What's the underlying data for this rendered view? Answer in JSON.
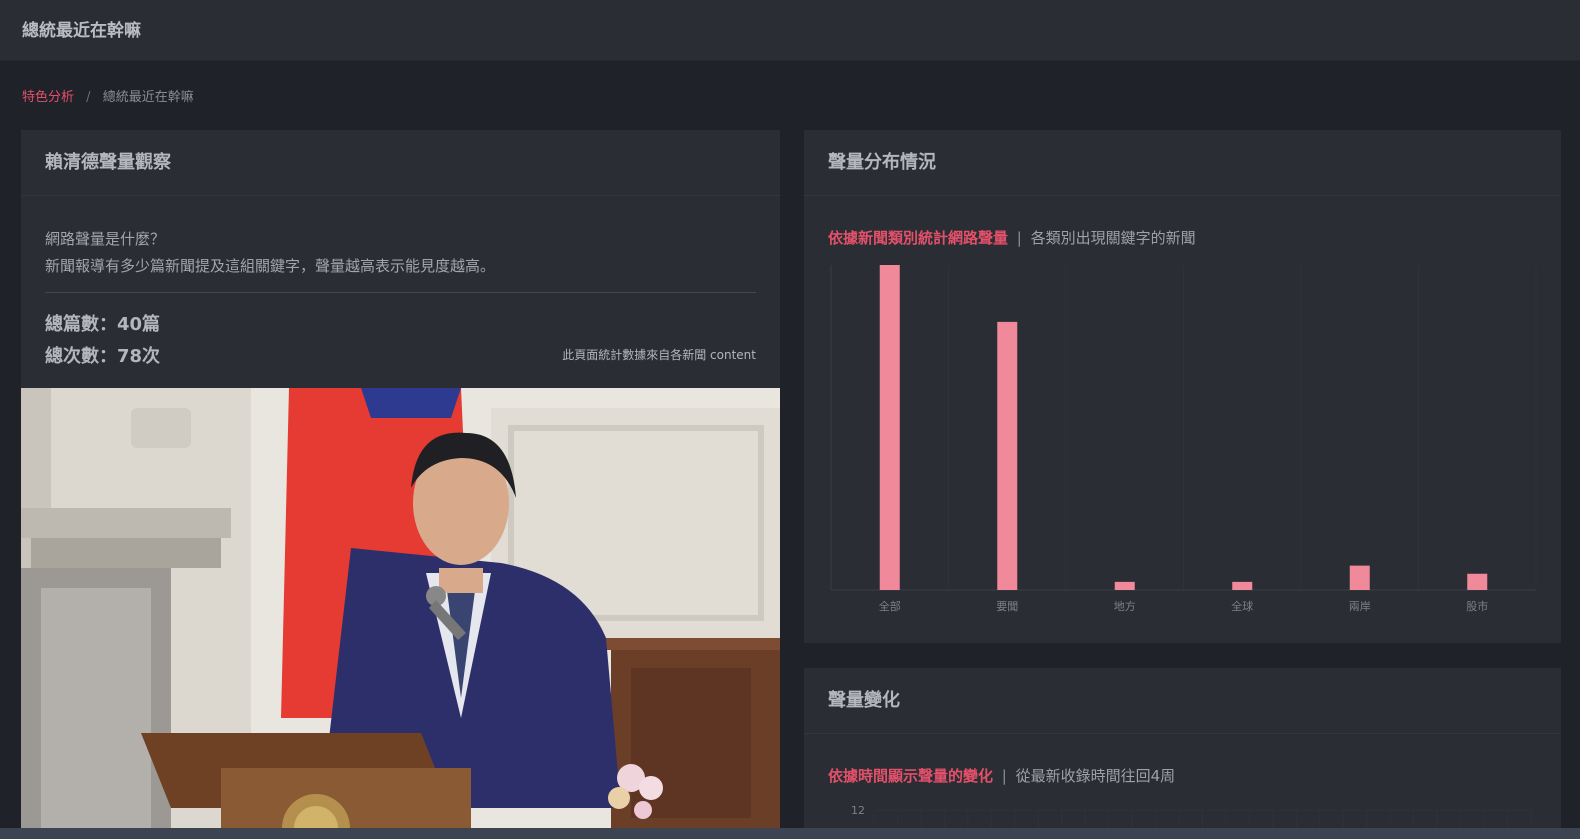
{
  "topbar": {
    "title": "總統最近在幹嘛"
  },
  "breadcrumb": {
    "parent": "特色分析",
    "separator": "/",
    "current": "總統最近在幹嘛"
  },
  "left_card": {
    "title": "賴清德聲量觀察",
    "desc_line1": "網路聲量是什麼？",
    "desc_line2": "新聞報導有多少篇新聞提及這組關鍵字，聲量越高表示能見度越高。",
    "total_articles": "總篇數：40篇",
    "total_mentions": "總次數：78次",
    "source_note": "此頁面統計數據來自各新聞 content"
  },
  "dist_card": {
    "title": "聲量分布情況",
    "subtitle_highlight": "依據新聞類別統計網路聲量",
    "subtitle_sep": "|",
    "subtitle_rest": "各類別出現關鍵字的新聞"
  },
  "trend_card": {
    "title": "聲量變化",
    "subtitle_highlight": "依據時間顯示聲量的變化",
    "subtitle_sep": "|",
    "subtitle_rest": "從最新收錄時間往回4周"
  },
  "colors": {
    "accent": "#e2506a",
    "bar": "#f08a9a",
    "background": "#1f2228",
    "card": "#2a2d33"
  },
  "chart_data": [
    {
      "type": "bar",
      "categories": [
        "全部",
        "要聞",
        "地方",
        "全球",
        "兩岸",
        "股市"
      ],
      "values": [
        40,
        33,
        1,
        1,
        3,
        2
      ],
      "ylim": [
        0,
        40
      ],
      "grid": true,
      "legend": "none"
    },
    {
      "type": "line",
      "yticks": [
        "12"
      ],
      "ylim": [
        0,
        12
      ],
      "grid": true
    }
  ]
}
